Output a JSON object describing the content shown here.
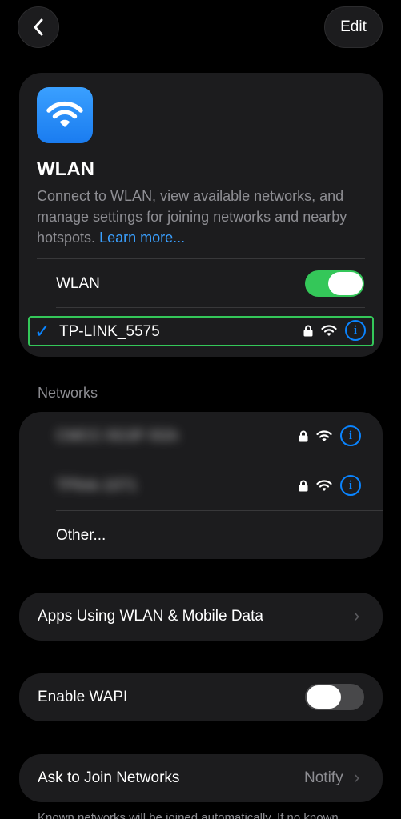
{
  "header": {
    "back_icon": "chevron-left-icon",
    "edit_label": "Edit"
  },
  "hero": {
    "icon": "wifi-icon",
    "title": "WLAN",
    "description": "Connect to WLAN, view available networks, and manage settings for joining networks and nearby hotspots.",
    "link_text": "Learn more..."
  },
  "wlan_toggle": {
    "label": "WLAN",
    "state": "on"
  },
  "current_network": {
    "name": "TP-LINK_5575",
    "selected": true,
    "secured": true
  },
  "networks": {
    "header": "Networks",
    "items": [
      {
        "name": "CMCC-5G3F-5Gh",
        "secured": true
      },
      {
        "name": "TPlink-1071",
        "secured": true
      }
    ],
    "other_label": "Other..."
  },
  "apps_using": {
    "label": "Apps Using WLAN & Mobile Data"
  },
  "wapi": {
    "label": "Enable WAPI",
    "state": "off"
  },
  "ask_join": {
    "label": "Ask to Join Networks",
    "value": "Notify"
  },
  "footer": {
    "text": "Known networks will be joined automatically. If no known"
  },
  "colors": {
    "accent": "#0a84ff",
    "toggle_on": "#34c759",
    "card_bg": "#1c1c1e",
    "background": "#000000"
  }
}
